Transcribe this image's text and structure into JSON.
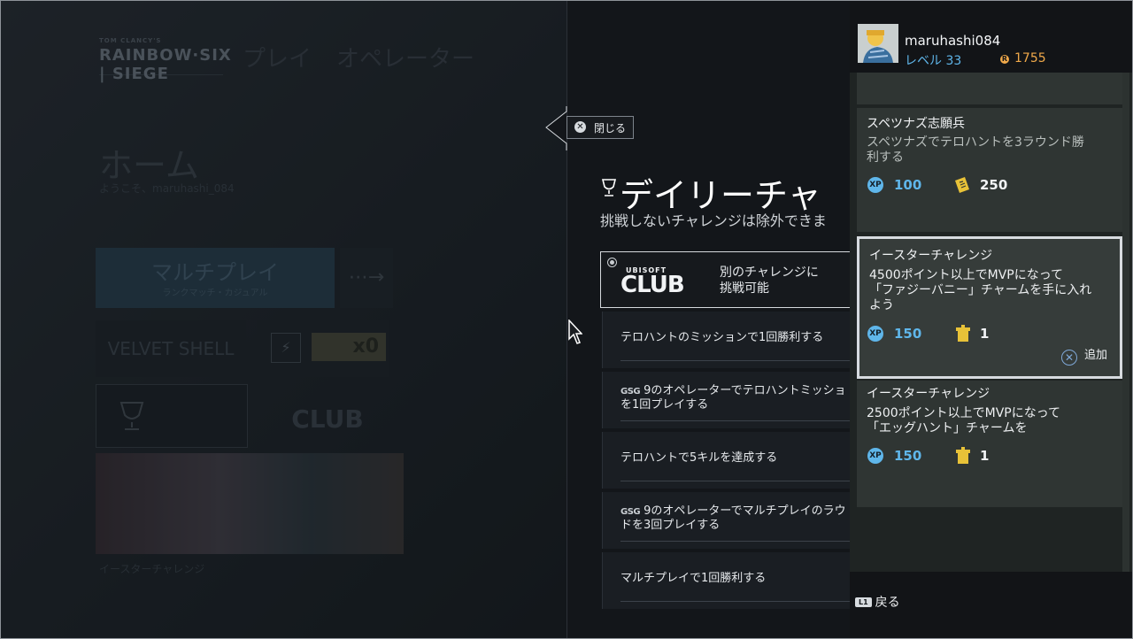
{
  "background": {
    "logo_small": "TOM CLANCY'S",
    "logo_main": "RAINBOW·SIX | SIEGE",
    "nav": [
      "プレイ",
      "オペレーター"
    ],
    "page_title": "ホーム",
    "welcome": "ようこそ、maruhashi_084",
    "multiplayer_title": "マルチプレイ",
    "multiplayer_sub": "ランクマッチ・カジュアル",
    "arrow": "⋯→",
    "velvet_shell": "VELVET SHELL",
    "boost_count": "x0",
    "club_logo": "CLUB",
    "easter_label": "イースターチャレンジ"
  },
  "overlay": {
    "close_label": "閉じる",
    "title": "デイリーチャ",
    "subtitle": "挑戦しないチャレンジは除外できま",
    "club_brand": "UBISOFT",
    "club_word": "CLUB",
    "club_text_1": "別のチャレンジに",
    "club_text_2": "挑戦可能",
    "items": [
      {
        "prefix": "",
        "line1": "テロハントのミッションで1回勝利する",
        "line2": ""
      },
      {
        "prefix": "GSG",
        "line1": "9のオペレーターでテロハントミッショ",
        "line2": "を1回プレイする"
      },
      {
        "prefix": "",
        "line1": "テロハントで5キルを達成する",
        "line2": ""
      },
      {
        "prefix": "GSG",
        "line1": "9のオペレーターでマルチプレイのラウ",
        "line2": "ドを3回プレイする"
      },
      {
        "prefix": "",
        "line1": "マルチプレイで1回勝利する",
        "line2": ""
      }
    ]
  },
  "user": {
    "name": "maruhashi084",
    "level": "レベル 33",
    "coins": "1755"
  },
  "cards": [
    {
      "title": "スペツナズ志願兵",
      "desc_1": "スペツナズでテロハントを3ラウンド勝",
      "desc_2": "利する",
      "desc_3": "",
      "xp": "100",
      "reward": "250",
      "reward_icon": "renown-ticket-icon"
    },
    {
      "title": "イースターチャレンジ",
      "desc_1": "4500ポイント以上でMVPになって",
      "desc_2": "「ファジーバニー」チャームを手に入れ",
      "desc_3": "よう",
      "xp": "150",
      "reward": "1",
      "reward_icon": "alpha-pack-icon",
      "add_label": "追加"
    },
    {
      "title": "イースターチャレンジ",
      "desc_1": "2500ポイント以上でMVPになって",
      "desc_2": "「エッグハント」チャームを",
      "desc_3": "",
      "xp": "150",
      "reward": "1",
      "reward_icon": "alpha-pack-icon"
    }
  ],
  "footer": {
    "l1": "L1",
    "back_label": "戻る"
  },
  "colors": {
    "xp_blue": "#5fb6ea",
    "coin_orange": "#f0a94a",
    "selected_border": "#d7dbdf"
  }
}
